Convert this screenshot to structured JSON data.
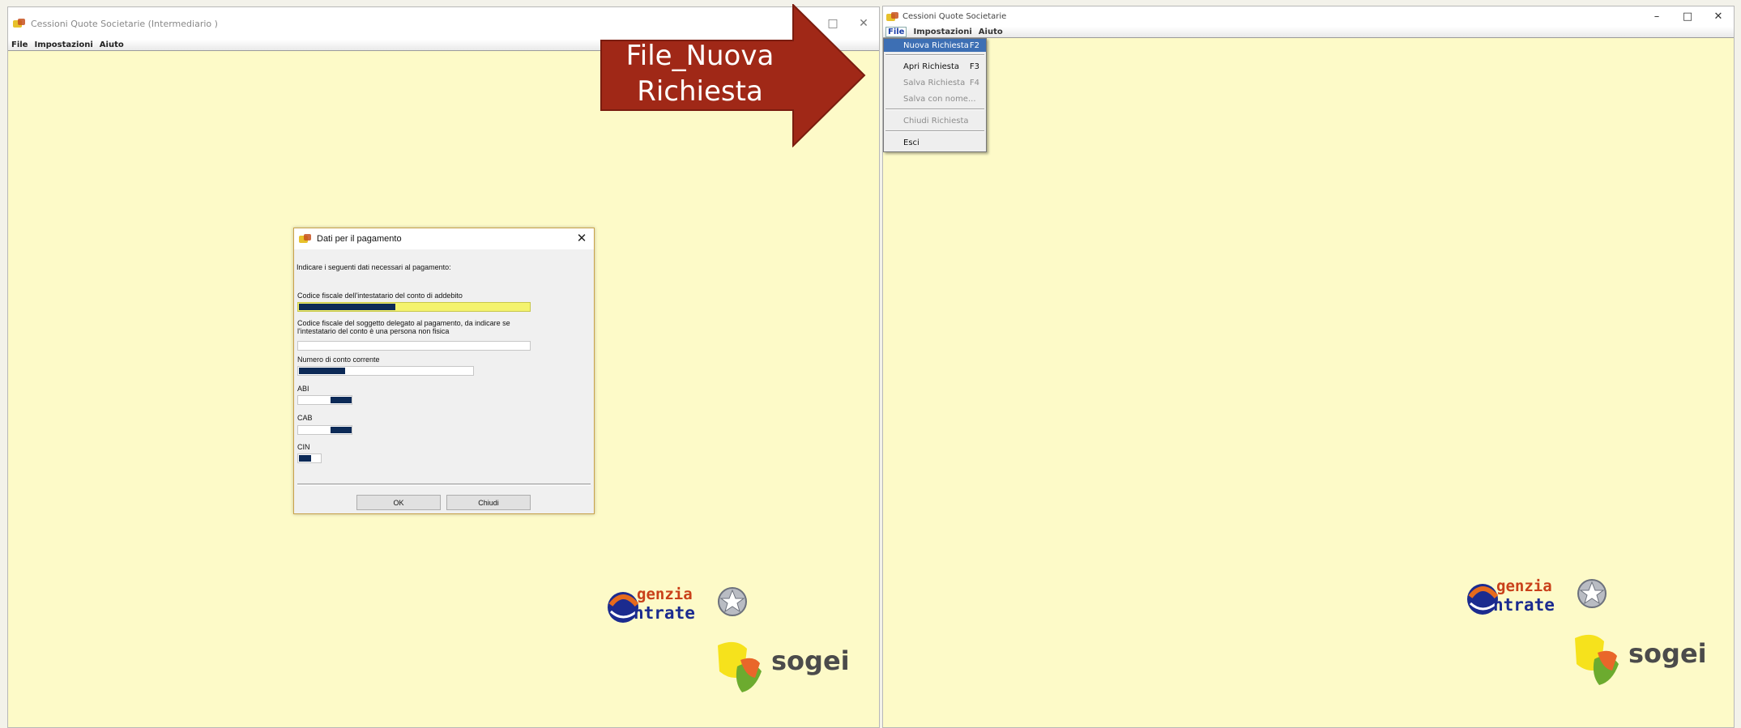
{
  "colors": {
    "window_bg": "#fdfac8",
    "arrow": "#a02817",
    "selection": "#3d6fb4",
    "field_fill": "#0c2a57",
    "required_field": "#f4f36e"
  },
  "left_window": {
    "title": "Cessioni Quote Societarie (Intermediario )",
    "controls": {
      "maximize": "□",
      "close": "✕"
    },
    "menu": [
      "File",
      "Impostazioni",
      "Aiuto"
    ]
  },
  "dialog": {
    "title": "Dati per il pagamento",
    "intro": "Indicare i seguenti dati necessari al pagamento:",
    "fields": [
      {
        "label": "Codice fiscale dell'intestatario del conto di addebito",
        "required": true,
        "filled_fraction": 0.42
      },
      {
        "label": "Codice fiscale del soggetto delegato al pagamento, da indicare se l'intestatario del conto è una persona non fisica",
        "required": false,
        "filled_fraction": 0
      },
      {
        "label": "Numero di conto corrente",
        "required": false,
        "filled_fraction": 0.27
      },
      {
        "label": "ABI"
      },
      {
        "label": "CAB"
      },
      {
        "label": "CIN"
      }
    ],
    "ok_label": "OK",
    "close_label": "Chiudi",
    "close_icon": "✕"
  },
  "callout": {
    "line1": "File_Nuova",
    "line2": "Richiesta"
  },
  "right_window": {
    "title": "Cessioni Quote Societarie",
    "controls": {
      "minimize": "–",
      "maximize": "□",
      "close": "✕"
    },
    "menu": [
      "File",
      "Impostazioni",
      "Aiuto"
    ],
    "file_menu": [
      {
        "label": "Nuova Richiesta",
        "shortcut": "F2",
        "enabled": true,
        "selected": true
      },
      {
        "label": "Apri Richiesta",
        "shortcut": "F3",
        "enabled": true
      },
      {
        "label": "Salva Richiesta",
        "shortcut": "F4",
        "enabled": false
      },
      {
        "label": "Salva con nome...",
        "shortcut": "",
        "enabled": false
      },
      {
        "label": "Chiudi Richiesta",
        "shortcut": "",
        "enabled": false
      },
      {
        "label": "Esci",
        "shortcut": "",
        "enabled": true
      }
    ]
  },
  "logos": {
    "agenzia_line1": "genzia",
    "agenzia_line2": "ntrate",
    "sogei": "sogei"
  }
}
